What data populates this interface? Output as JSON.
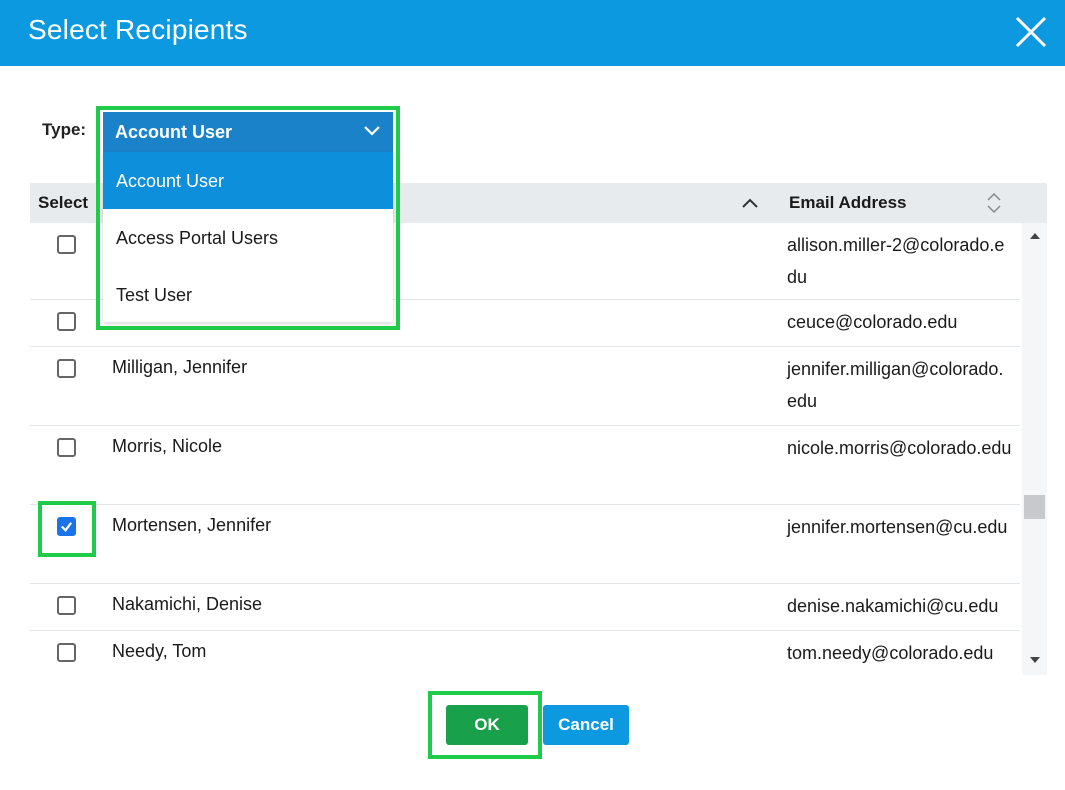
{
  "dialog": {
    "title": "Select Recipients",
    "close_icon": "close-icon"
  },
  "type_filter": {
    "label": "Type:",
    "selected": "Account User",
    "options": [
      "Account User",
      "Access Portal Users",
      "Test User"
    ]
  },
  "grid": {
    "columns": {
      "select": "Select",
      "email": "Email Address"
    },
    "rows": [
      {
        "name": "",
        "email": "allison.miller-2@colorado.edu",
        "checked": false
      },
      {
        "name": "",
        "email": "ceuce@colorado.edu",
        "checked": false
      },
      {
        "name": "Milligan, Jennifer",
        "email": "jennifer.milligan@colorado.edu",
        "checked": false
      },
      {
        "name": "Morris, Nicole",
        "email": "nicole.morris@colorado.edu",
        "checked": false
      },
      {
        "name": "Mortensen, Jennifer",
        "email": "jennifer.mortensen@cu.edu",
        "checked": true
      },
      {
        "name": "Nakamichi, Denise",
        "email": "denise.nakamichi@cu.edu",
        "checked": false
      },
      {
        "name": "Needy, Tom",
        "email": "tom.needy@colorado.edu",
        "checked": false
      }
    ]
  },
  "buttons": {
    "ok": "OK",
    "cancel": "Cancel"
  },
  "colors": {
    "header": "#0d99e0",
    "ok": "#19a04a",
    "highlight": "#1ecc4a",
    "selected_option": "#0d8fdc"
  }
}
